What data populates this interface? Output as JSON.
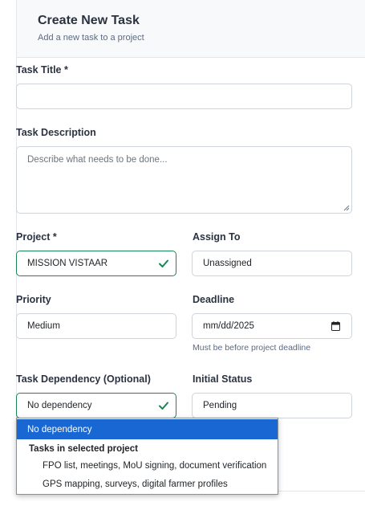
{
  "header": {
    "title": "Create New Task",
    "subtitle": "Add a new task to a project"
  },
  "form": {
    "task_title": {
      "label": "Task Title *",
      "value": ""
    },
    "task_description": {
      "label": "Task Description",
      "placeholder": "Describe what needs to be done..."
    },
    "project": {
      "label": "Project *",
      "value": "MISSION VISTAAR"
    },
    "assign_to": {
      "label": "Assign To",
      "value": "Unassigned"
    },
    "priority": {
      "label": "Priority",
      "value": "Medium"
    },
    "deadline": {
      "label": "Deadline",
      "value": "mm/dd/2025",
      "help": "Must be before project deadline"
    },
    "task_dependency": {
      "label": "Task Dependency (Optional)",
      "value": "No dependency"
    },
    "initial_status": {
      "label": "Initial Status",
      "value": "Pending"
    }
  },
  "dependency_dropdown": {
    "selected": "No dependency",
    "group_label": "Tasks in selected project",
    "options": [
      "FPO list, meetings, MoU signing, document verification",
      "GPS mapping, surveys, digital farmer profiles"
    ]
  },
  "colors": {
    "valid_border": "#198754",
    "selected_option_bg": "#1967d2",
    "header_bg": "#f8f9fa"
  },
  "icons": {
    "valid": "check-icon",
    "date": "calendar-icon",
    "resize": "resize-handle-icon"
  }
}
